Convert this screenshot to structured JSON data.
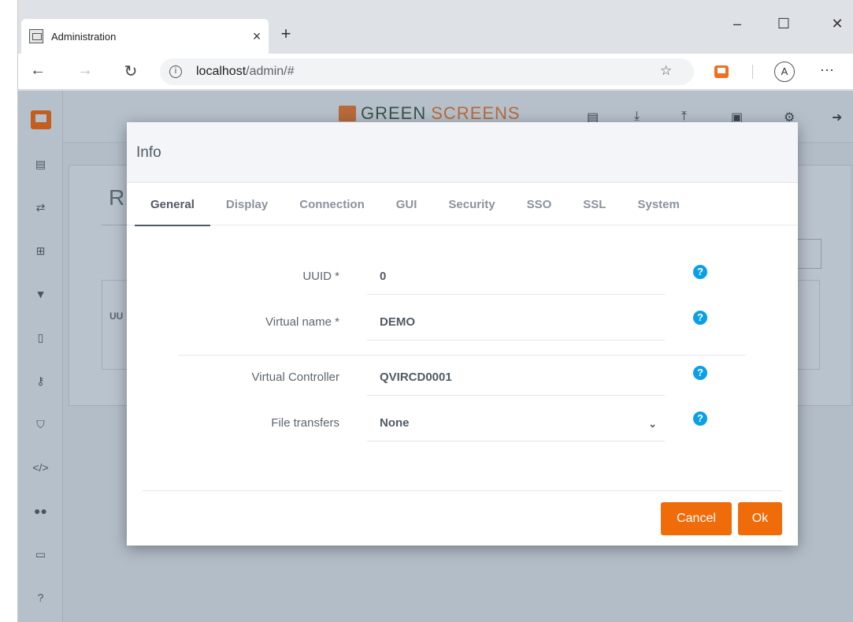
{
  "browser": {
    "tab_title": "Administration",
    "tab_close": "×",
    "new_tab": "+",
    "window_minimize": "–",
    "window_maximize": "☐",
    "window_close": "✕",
    "back": "←",
    "forward": "→",
    "reload": "↻",
    "info": "i",
    "url_host": "localhost",
    "url_path": "/admin/#",
    "star": "☆",
    "profile": "A",
    "more": "···"
  },
  "app": {
    "brand_green": "GREEN",
    "brand_screens": "SCREENS",
    "background_heading_initial": "R",
    "background_column_initial": "UU"
  },
  "modal": {
    "title": "Info",
    "tabs": [
      {
        "label": "General",
        "active": true
      },
      {
        "label": "Display"
      },
      {
        "label": "Connection"
      },
      {
        "label": "GUI"
      },
      {
        "label": "Security"
      },
      {
        "label": "SSO"
      },
      {
        "label": "SSL"
      },
      {
        "label": "System"
      }
    ],
    "fields": [
      {
        "label": "UUID *",
        "value": "0"
      },
      {
        "label": "Virtual name *",
        "value": "DEMO"
      },
      {
        "label": "Virtual Controller",
        "value": "QVIRCD0001"
      },
      {
        "label": "File transfers",
        "value": "None"
      }
    ],
    "help_glyph": "?",
    "select_arrow": "⌄",
    "cancel_label": "Cancel",
    "ok_label": "Ok"
  },
  "icons": {
    "sidebar": [
      "monitor-icon",
      "list-icon",
      "transfer-icon",
      "sitemap-icon",
      "filter-icon",
      "mobile-icon",
      "key-icon",
      "shield-icon",
      "code-icon",
      "users-icon",
      "desktop-icon",
      "help-icon"
    ],
    "topbar": [
      "list-icon",
      "download-icon",
      "upload-icon",
      "id-card-icon",
      "gears-icon",
      "sign-out-icon"
    ]
  },
  "colors": {
    "accent": "#f06c0a",
    "help": "#0aa0e8",
    "brand_orange": "#b86a3a"
  }
}
